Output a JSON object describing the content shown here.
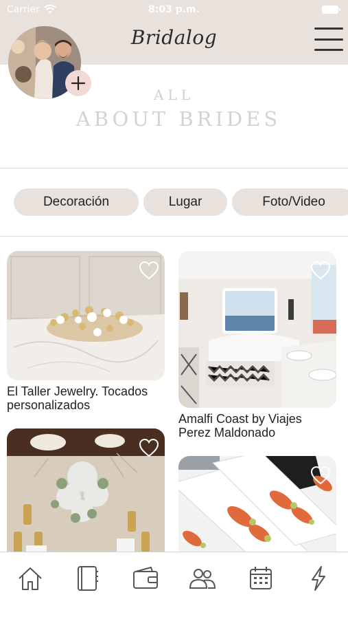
{
  "status_bar": {
    "carrier": "Carrier",
    "time": "8:03 p.m."
  },
  "header": {
    "brand": "Bridalog"
  },
  "hero": {
    "line1": "ALL",
    "line2": "ABOUT BRIDES"
  },
  "categories": [
    "Decoración",
    "Lugar",
    "Foto/Video"
  ],
  "cards": [
    {
      "caption": "El Taller Jewelry. Tocados personalizados"
    },
    {
      "caption": "Amalfi Coast by Viajes Perez Maldonado"
    },
    {
      "caption": ""
    },
    {
      "caption": ""
    }
  ],
  "tabs": [
    "home-icon",
    "notebook-icon",
    "wallet-icon",
    "people-icon",
    "calendar-icon",
    "lightning-icon"
  ],
  "colors": {
    "header_bg": "#e8e1dc",
    "chip_bg": "#e8e1dc",
    "add_button_bg": "#f3d9d5",
    "hero_text": "#d6d2cf"
  }
}
